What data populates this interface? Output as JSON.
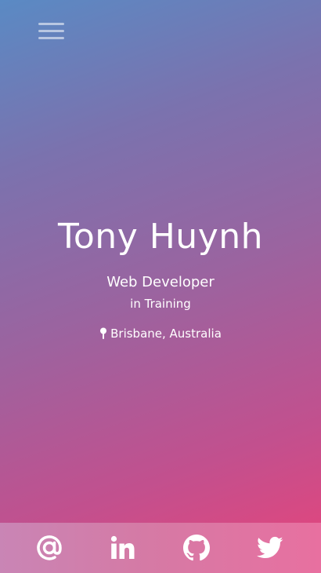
{
  "header": {
    "menu_icon": "hamburger-menu-icon"
  },
  "profile": {
    "name": "Tony Huynh",
    "role": "Web Developer",
    "role_sub": "in Training",
    "location_icon": "map-pin-icon",
    "location": "Brisbane, Australia"
  },
  "social": {
    "items": [
      {
        "icon": "at-sign-icon"
      },
      {
        "icon": "linkedin-icon"
      },
      {
        "icon": "github-icon"
      },
      {
        "icon": "twitter-icon"
      }
    ]
  },
  "colors": {
    "gradient_top_left": "#5a8ac4",
    "gradient_bottom_right": "#e8447a",
    "text": "#ffffff",
    "social_bar": "#d57aa5"
  }
}
